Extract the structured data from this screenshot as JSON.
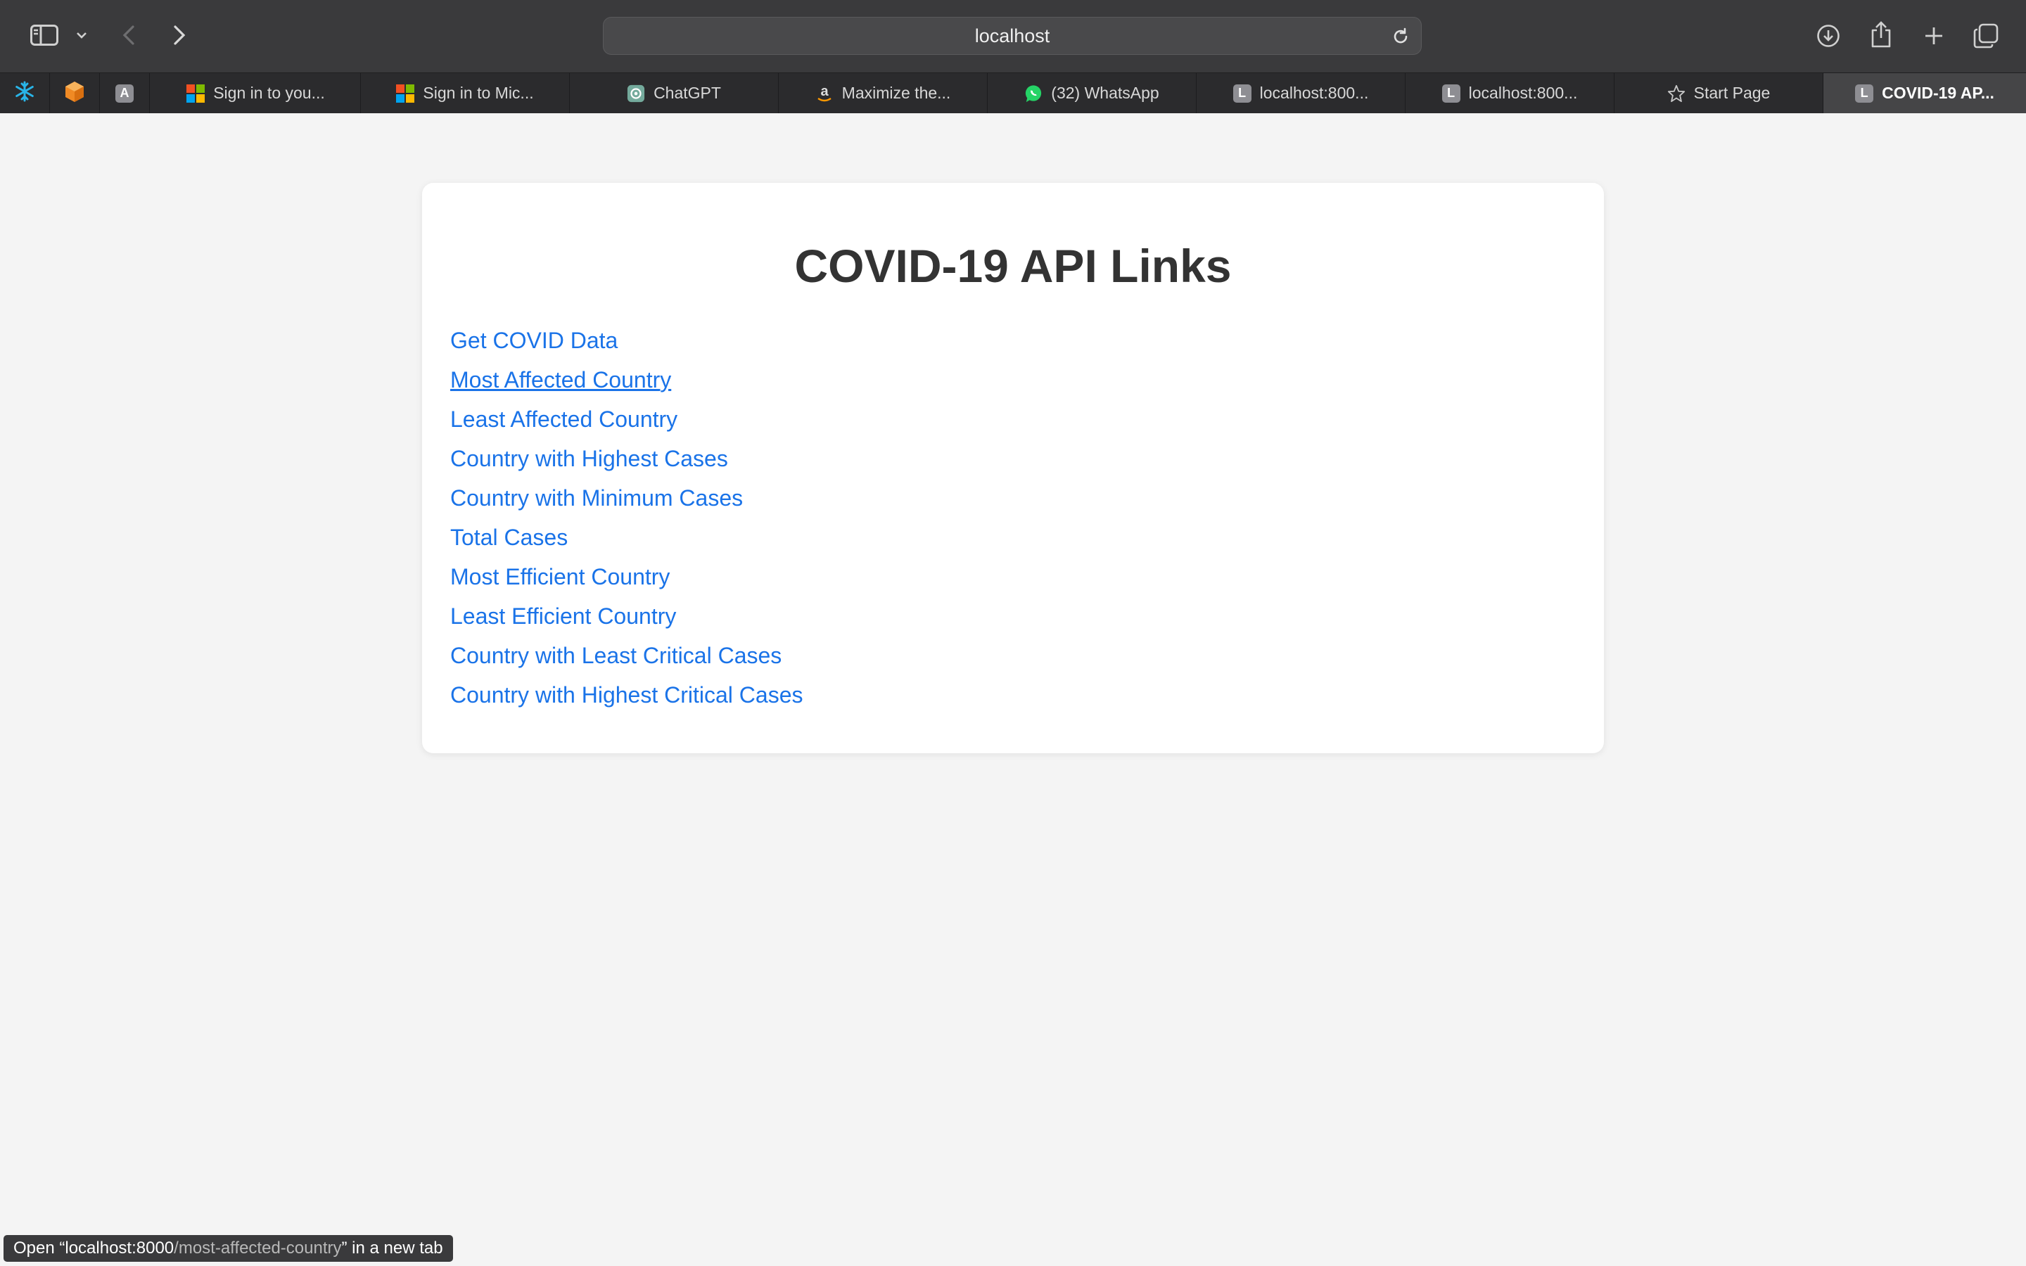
{
  "browser": {
    "address": "localhost",
    "pinned_tabs": [
      {
        "icon": "snowflake-icon",
        "color": "#29b5e8"
      },
      {
        "icon": "orange-cube-icon",
        "color": "#f08a24"
      },
      {
        "icon": "letter-a-icon",
        "letter": "A"
      }
    ],
    "tabs": [
      {
        "title": "Sign in to you...",
        "icon": "microsoft-icon"
      },
      {
        "title": "Sign in to Mic...",
        "icon": "microsoft-icon"
      },
      {
        "title": "ChatGPT",
        "icon": "chatgpt-icon"
      },
      {
        "title": "Maximize the...",
        "icon": "amazon-icon"
      },
      {
        "title": "(32) WhatsApp",
        "icon": "whatsapp-icon"
      },
      {
        "title": "localhost:800...",
        "icon": "letter-l-icon",
        "letter": "L"
      },
      {
        "title": "localhost:800...",
        "icon": "letter-l-icon",
        "letter": "L"
      },
      {
        "title": "Start Page",
        "icon": "star-icon"
      },
      {
        "title": "COVID-19 AP...",
        "icon": "letter-l-icon",
        "letter": "L",
        "active": true
      }
    ]
  },
  "page": {
    "title": "COVID-19 API Links",
    "links": [
      "Get COVID Data",
      "Most Affected Country",
      "Least Affected Country",
      "Country with Highest Cases",
      "Country with Minimum Cases",
      "Total Cases",
      "Most Efficient Country",
      "Least Efficient Country",
      "Country with Least Critical Cases",
      "Country with Highest Critical Cases"
    ],
    "hovered_link_index": 1,
    "link_color": "#1a73e8"
  },
  "status": {
    "prefix": "Open “localhost:8000",
    "path": "/most-affected-country",
    "suffix": "” in a new tab"
  }
}
